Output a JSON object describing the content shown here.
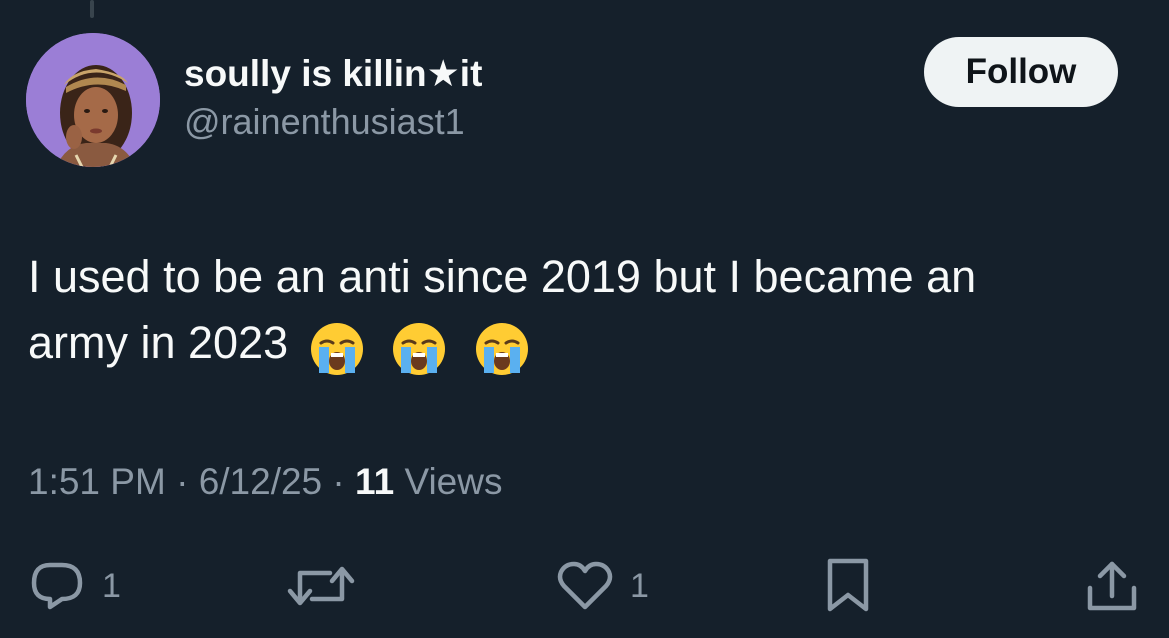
{
  "tweet": {
    "author": {
      "display_name": "soully is killin★it",
      "handle": "@rainenthusiast1",
      "avatar_color": "#9b7ed6"
    },
    "follow_label": "Follow",
    "text_line1": "I used to be an anti since 2019 but I became an",
    "text_line2": "army in 2023",
    "emojis": [
      "loudly-crying-face",
      "loudly-crying-face",
      "loudly-crying-face"
    ],
    "time": "1:51 PM",
    "separator": "·",
    "date": "6/12/25",
    "views_count": "11",
    "views_label": "Views"
  },
  "actions": {
    "reply": {
      "icon": "reply-icon",
      "count": "1"
    },
    "repost": {
      "icon": "repost-icon",
      "count": ""
    },
    "like": {
      "icon": "heart-icon",
      "count": "1"
    },
    "bookmark": {
      "icon": "bookmark-icon",
      "count": ""
    },
    "share": {
      "icon": "share-icon",
      "count": ""
    }
  },
  "colors": {
    "background": "#15202b",
    "secondary_text": "#8b98a5",
    "button_bg": "#eff3f4"
  }
}
